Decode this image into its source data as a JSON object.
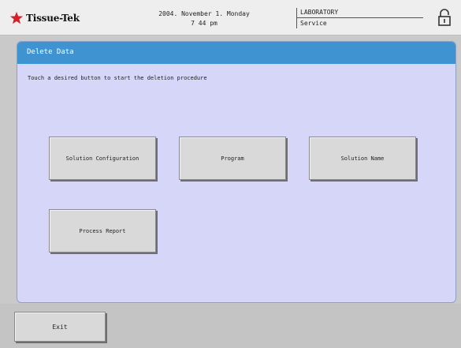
{
  "header": {
    "logo_text": "Tissue-Tek",
    "date": "2004. November 1. Monday",
    "time": "7 44 pm",
    "mode": "LABORATORY",
    "user": "Service"
  },
  "panel": {
    "title": "Delete Data",
    "instruction": "Touch a desired button to start the deletion procedure",
    "buttons": {
      "solution_configuration": "Solution Configuration",
      "program": "Program",
      "solution_name": "Solution Name",
      "process_report": "Process Report"
    }
  },
  "footer": {
    "exit_label": "Exit"
  },
  "colors": {
    "title_bar": "#3f93d0",
    "panel_bg": "#d6d6f8",
    "logo_star": "#d4202a",
    "chrome_bg": "#c9c9c9"
  },
  "icons": {
    "logo": "star-icon",
    "lock": "lock-icon"
  }
}
